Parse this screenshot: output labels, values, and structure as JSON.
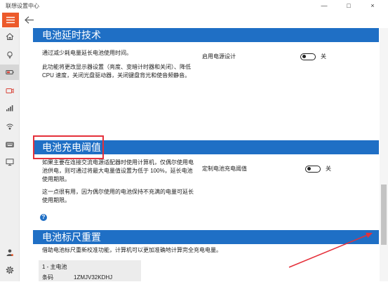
{
  "window": {
    "title": "联想设置中心",
    "minimize_label": "—",
    "maximize_label": "□",
    "close_label": "×"
  },
  "colors": {
    "accent": "#1f6fc5",
    "menu_button": "#ec5a2b",
    "annotation": "#e5303a"
  },
  "nav": {
    "menu_icon": "hamburger-icon",
    "back_icon": "back-arrow-icon",
    "items": [
      {
        "icon": "home-icon",
        "selected": false
      },
      {
        "icon": "lightbulb-icon",
        "selected": false
      },
      {
        "icon": "battery-icon",
        "selected": true
      },
      {
        "icon": "camera-icon",
        "selected": false
      },
      {
        "icon": "signal-icon",
        "selected": false
      },
      {
        "icon": "network-icon",
        "selected": false
      },
      {
        "icon": "keyboard-icon",
        "selected": false
      },
      {
        "icon": "monitor-icon",
        "selected": false
      }
    ],
    "bottom_items": [
      {
        "icon": "user-icon"
      },
      {
        "icon": "gear-icon"
      }
    ]
  },
  "battery_extender": {
    "title": "电池延时技术",
    "description": "通过减少耗电量延长电池使用时间。",
    "details": "此功能将更改显示器设置（亮度、变暗计时器和关闭）、降低 CPU 速度，关闭光盘驱动器，关闭键盘背光和使音频静音。",
    "setting_label": "启用电源设计",
    "toggle_on": false,
    "toggle_state_label": "关"
  },
  "charge_threshold": {
    "title": "电池充电阈值",
    "description": "如果主要在连接交流电源适配器时使用计算机，仅偶尔使用电池供电，则可通过将最大电量值设置为低于 100%，延长电池使用期限。",
    "details": "这一点很有用，因为偶尔使用的电池保持不充满的电量可延长使用期限。",
    "setting_label": "定制电池充电阈值",
    "toggle_on": false,
    "toggle_state_label": "关",
    "help_label": "?"
  },
  "gauge_reset": {
    "title": "电池标尺重置",
    "description": "借助电池标尺重新校准功能，计算机可以更加准确地计算完全充电电量。",
    "battery_name": "1 - 主电池",
    "barcode_label": "条码",
    "barcode_value": "1ZMJV32KDHJ"
  }
}
